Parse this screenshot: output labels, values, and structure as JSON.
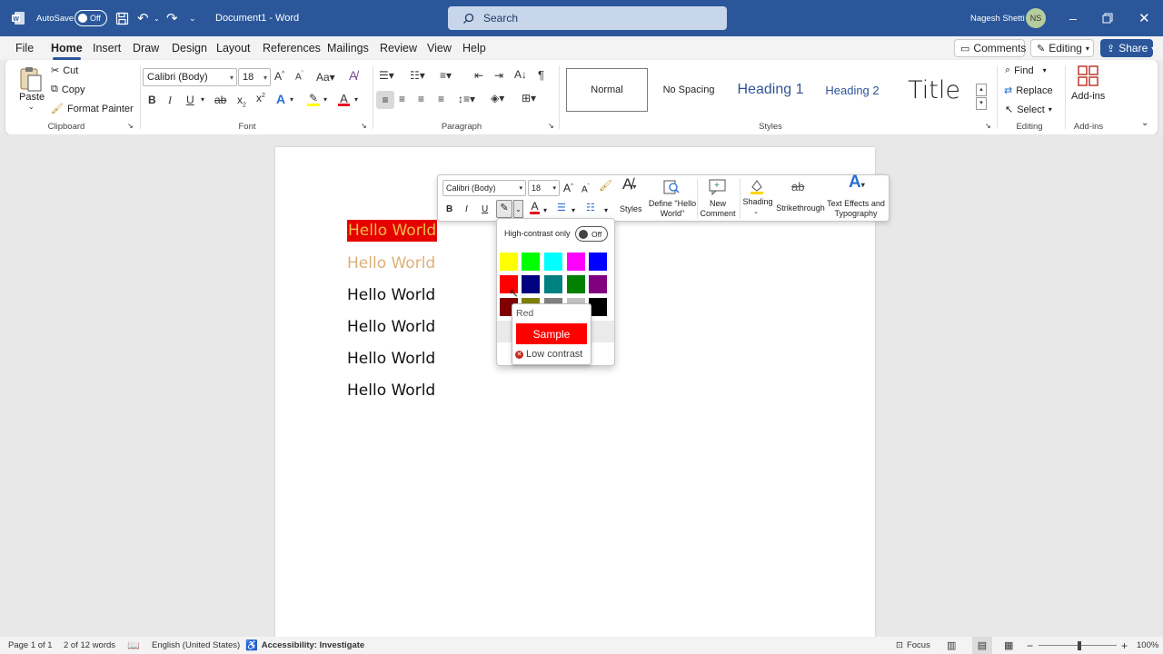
{
  "titlebar": {
    "autosave_label": "AutoSave",
    "autosave_state": "Off",
    "doc_title": "Document1  -  Word",
    "search_placeholder": "Search",
    "user_name": "Nagesh Shetti",
    "user_initials": "NS"
  },
  "menu": {
    "tabs": [
      "File",
      "Home",
      "Insert",
      "Draw",
      "Design",
      "Layout",
      "References",
      "Mailings",
      "Review",
      "View",
      "Help"
    ],
    "active": "Home",
    "comments": "Comments",
    "editing": "Editing",
    "share": "Share"
  },
  "ribbon": {
    "clipboard": {
      "paste": "Paste",
      "cut": "Cut",
      "copy": "Copy",
      "format_painter": "Format Painter",
      "label": "Clipboard"
    },
    "font": {
      "name": "Calibri (Body)",
      "size": "18",
      "label": "Font"
    },
    "paragraph": {
      "label": "Paragraph"
    },
    "styles": {
      "items": [
        "Normal",
        "No Spacing",
        "Heading 1",
        "Heading 2",
        "Title"
      ],
      "label": "Styles"
    },
    "editing": {
      "find": "Find",
      "replace": "Replace",
      "select": "Select",
      "label": "Editing"
    },
    "addins": {
      "button": "Add-ins",
      "label": "Add-ins"
    }
  },
  "document": {
    "lines": [
      "Hello World",
      "Hello World",
      "Hello World",
      "Hello World",
      "Hello World",
      "Hello World"
    ]
  },
  "mini_toolbar": {
    "font": "Calibri (Body)",
    "size": "18",
    "styles": "Styles",
    "define_1": "Define \"Hello",
    "define_2": "World\"",
    "new_1": "New",
    "new_2": "Comment",
    "shading": "Shading",
    "strikethrough": "Strikethrough",
    "effects_1": "Text Effects and",
    "effects_2": "Typography"
  },
  "highlight_picker": {
    "high_contrast_label": "High-contrast only",
    "toggle_state": "Off",
    "colors": [
      "#ffff00",
      "#00ff00",
      "#00ffff",
      "#ff00ff",
      "#0000ff",
      "#ff0000",
      "#000080",
      "#008080",
      "#008000",
      "#800080",
      "#800000",
      "#808000",
      "#808080",
      "#c0c0c0",
      "#000000"
    ],
    "tooltip": {
      "name": "Red",
      "sample": "Sample",
      "warning": "Low contrast"
    }
  },
  "status": {
    "page": "Page 1 of 1",
    "words": "2 of 12 words",
    "language": "English (United States)",
    "accessibility": "Accessibility: Investigate",
    "focus": "Focus",
    "zoom": "100%"
  }
}
